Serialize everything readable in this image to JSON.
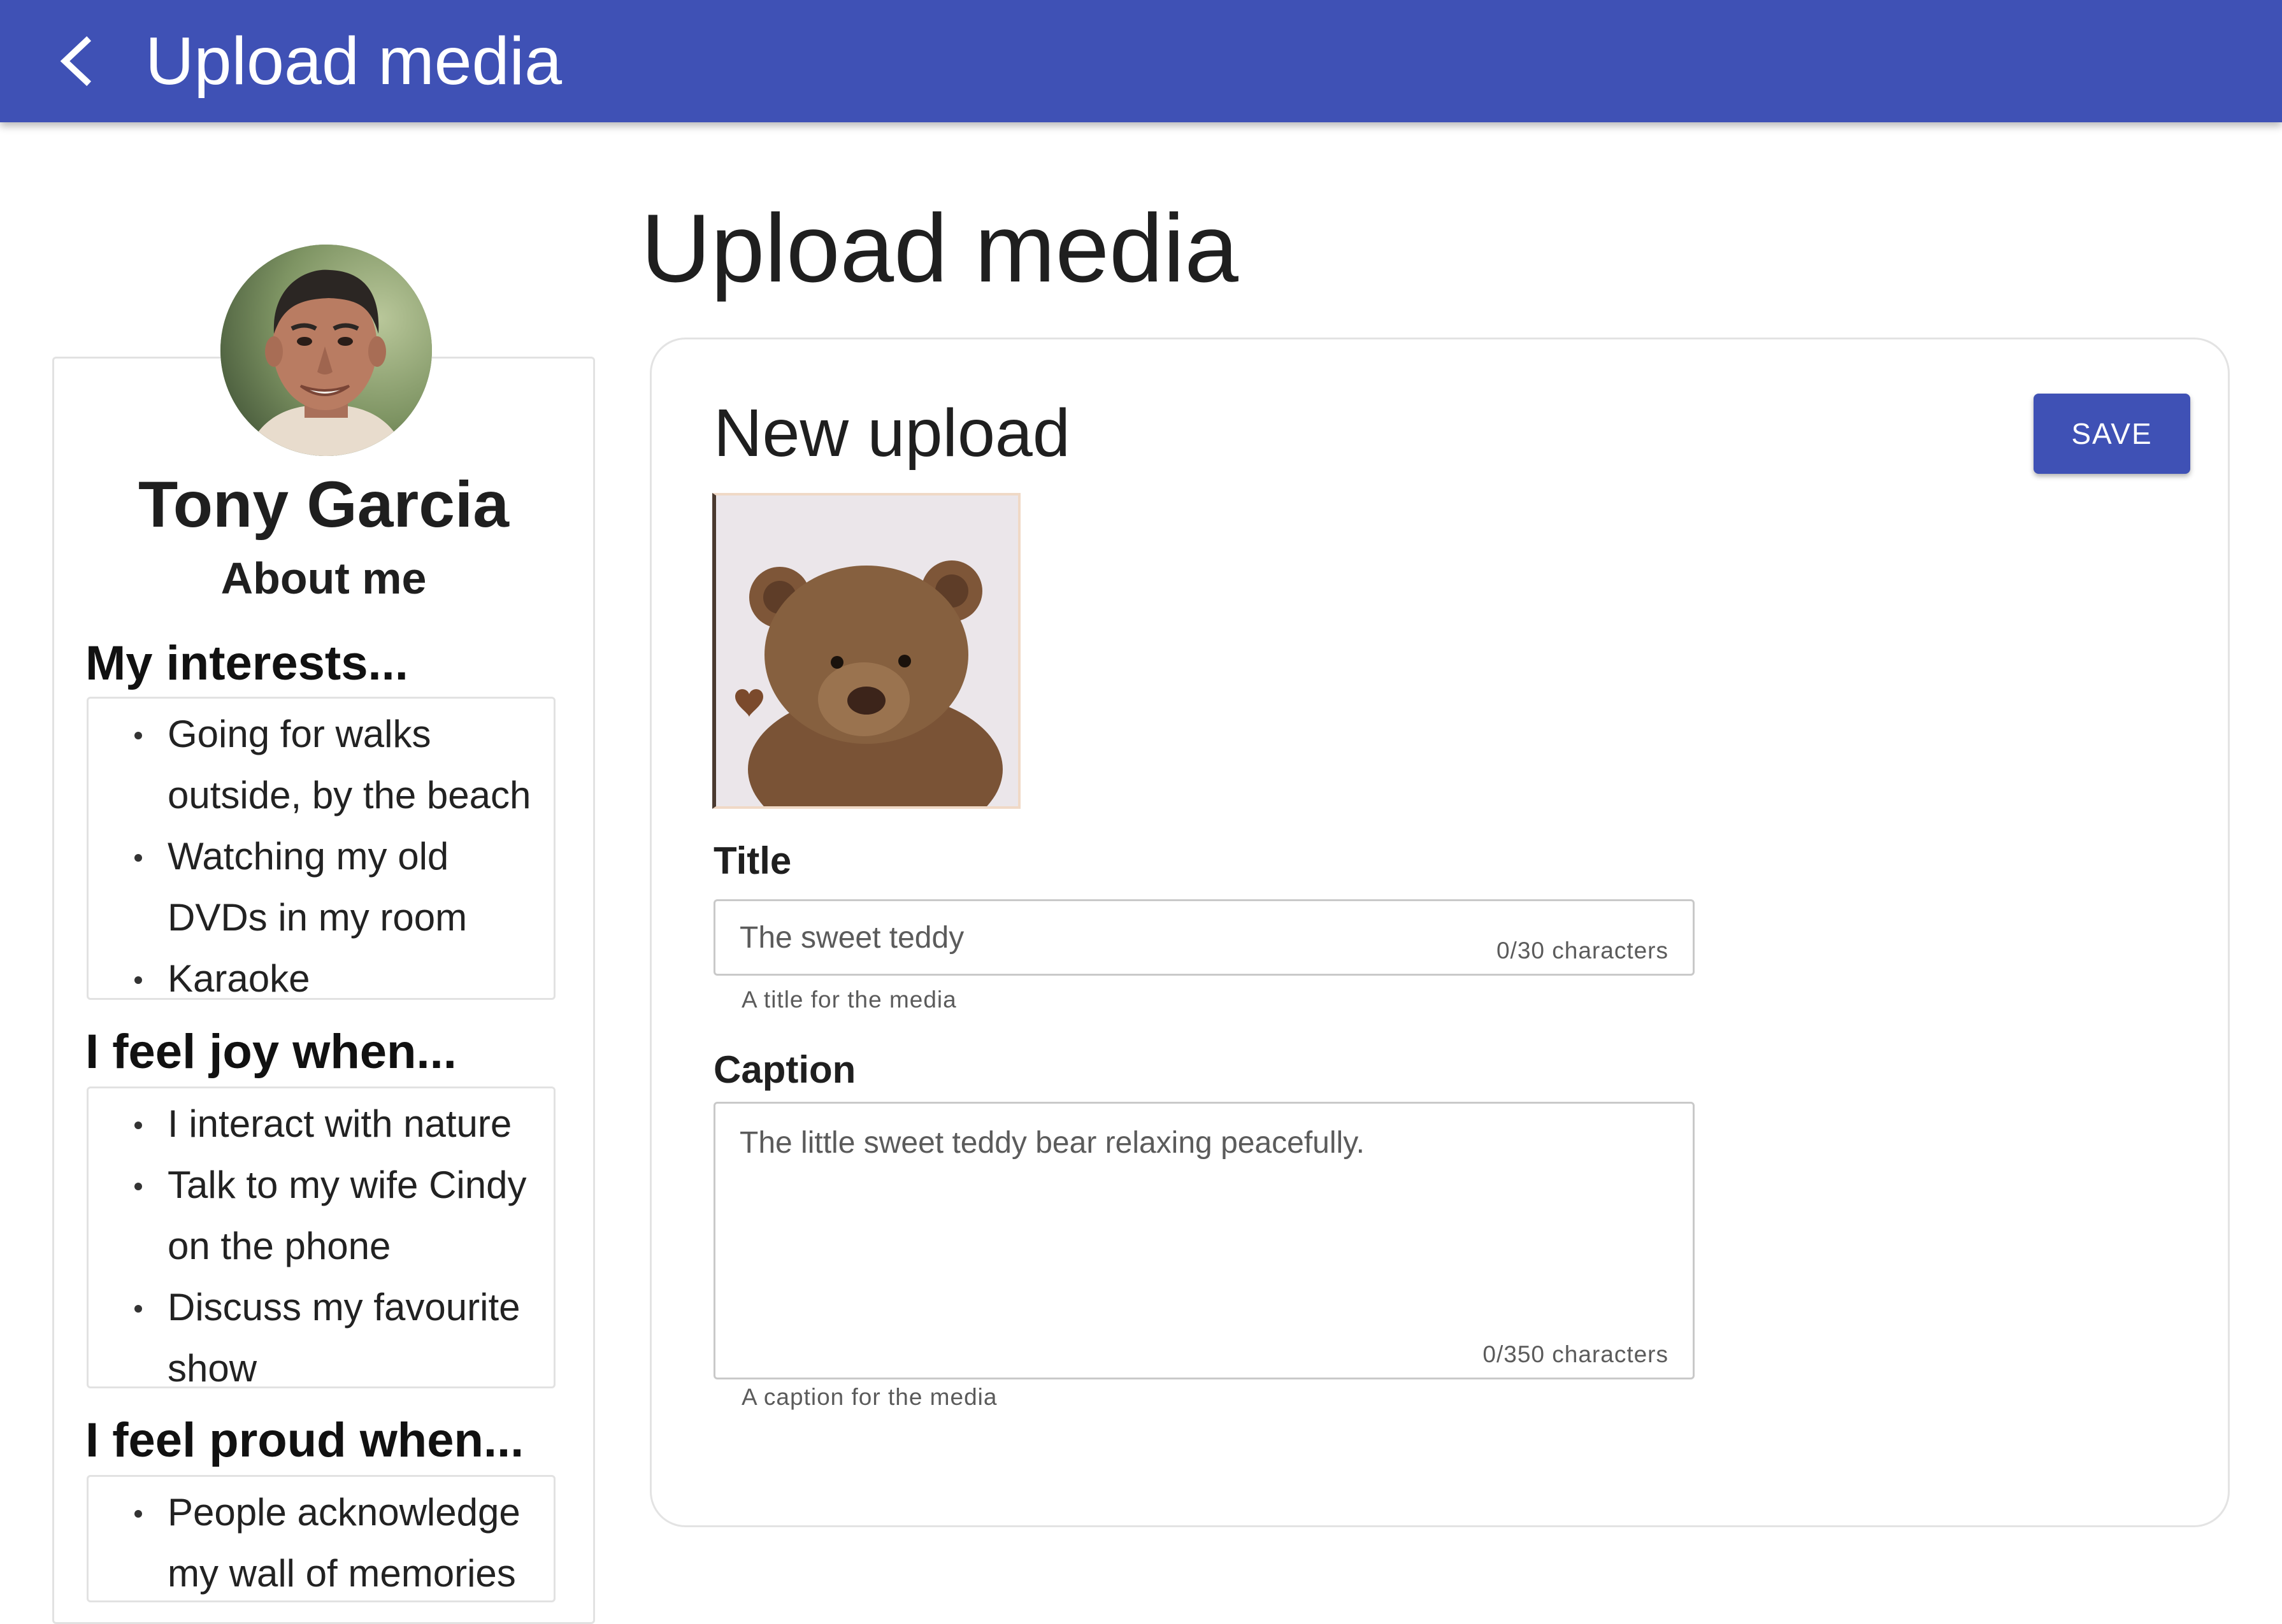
{
  "app_bar": {
    "title": "Upload media",
    "back_icon": "chevron-left-icon",
    "background": "#3f51b5"
  },
  "profile": {
    "name": "Tony Garcia",
    "about_label": "About me",
    "sections": [
      {
        "heading": "My interests...",
        "items": [
          "Going for walks outside, by the beach",
          "Watching my old DVDs in my room",
          "Karaoke"
        ]
      },
      {
        "heading": "I feel joy when...",
        "items": [
          "I interact with nature",
          "Talk to my wife Cindy on the phone",
          "Discuss my favourite show"
        ]
      },
      {
        "heading": "I feel proud when...",
        "items": [
          "People acknowledge my wall of memories"
        ]
      }
    ]
  },
  "main": {
    "page_title": "Upload media",
    "card_title": "New upload",
    "save_label": "SAVE",
    "title_field": {
      "label": "Title",
      "value": "The sweet teddy",
      "counter": "0/30 characters",
      "helper": "A title for the media"
    },
    "caption_field": {
      "label": "Caption",
      "value": "The little sweet teddy bear relaxing peacefully.",
      "counter": "0/350 characters",
      "helper": "A caption for the media"
    }
  }
}
